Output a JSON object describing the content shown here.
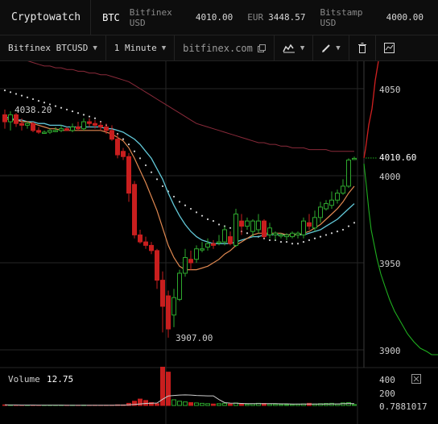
{
  "header": {
    "brand": "Cryptowatch",
    "symbol": "BTC",
    "tickers": [
      {
        "exchange": "Bitfinex USD",
        "value": "4010.00"
      },
      {
        "exchange": "EUR",
        "value": "3448.57"
      },
      {
        "exchange": "Bitstamp USD",
        "value": "4000.00"
      }
    ]
  },
  "toolbar": {
    "market": "Bitfinex BTCUSD",
    "interval": "1 Minute",
    "site": "bitfinex.com"
  },
  "chart_data": {
    "type": "candlestick",
    "price_ticks": [
      "4050",
      "4000",
      "3950",
      "3900"
    ],
    "last_price": "4010.60",
    "high_label": "4038.20",
    "low_label": "3907.00",
    "volume_label": "Volume",
    "volume_value": "12.75",
    "volume_ticks": [
      "400",
      "200",
      "0.7881017"
    ],
    "colors": {
      "up": "#2ea82e",
      "down": "#c81e1e",
      "ma_fast": "#e08850",
      "ma_slow": "#62c8d8",
      "ema": "#8a2a3a"
    },
    "candles": [
      {
        "o": 4035,
        "h": 4038,
        "l": 4027,
        "c": 4031
      },
      {
        "o": 4031,
        "h": 4037,
        "l": 4026,
        "c": 4035
      },
      {
        "o": 4035,
        "h": 4036,
        "l": 4028,
        "c": 4030
      },
      {
        "o": 4030,
        "h": 4033,
        "l": 4026,
        "c": 4029
      },
      {
        "o": 4029,
        "h": 4031,
        "l": 4027,
        "c": 4030
      },
      {
        "o": 4030,
        "h": 4031,
        "l": 4025,
        "c": 4026
      },
      {
        "o": 4026,
        "h": 4028,
        "l": 4024,
        "c": 4025
      },
      {
        "o": 4025,
        "h": 4026,
        "l": 4024,
        "c": 4025
      },
      {
        "o": 4025,
        "h": 4027,
        "l": 4024,
        "c": 4026
      },
      {
        "o": 4026,
        "h": 4028,
        "l": 4025,
        "c": 4026
      },
      {
        "o": 4026,
        "h": 4029,
        "l": 4025,
        "c": 4027
      },
      {
        "o": 4027,
        "h": 4028,
        "l": 4026,
        "c": 4026
      },
      {
        "o": 4026,
        "h": 4030,
        "l": 4025,
        "c": 4028
      },
      {
        "o": 4028,
        "h": 4031,
        "l": 4026,
        "c": 4027
      },
      {
        "o": 4027,
        "h": 4033,
        "l": 4026,
        "c": 4031
      },
      {
        "o": 4031,
        "h": 4033,
        "l": 4028,
        "c": 4030
      },
      {
        "o": 4030,
        "h": 4032,
        "l": 4027,
        "c": 4029
      },
      {
        "o": 4029,
        "h": 4031,
        "l": 4026,
        "c": 4028
      },
      {
        "o": 4028,
        "h": 4030,
        "l": 4024,
        "c": 4026
      },
      {
        "o": 4026,
        "h": 4029,
        "l": 4020,
        "c": 4021
      },
      {
        "o": 4021,
        "h": 4024,
        "l": 4010,
        "c": 4012
      },
      {
        "o": 4014,
        "h": 4016,
        "l": 4009,
        "c": 4011
      },
      {
        "o": 4011,
        "h": 4013,
        "l": 3985,
        "c": 3990
      },
      {
        "o": 3995,
        "h": 3997,
        "l": 3964,
        "c": 3966
      },
      {
        "o": 3966,
        "h": 3969,
        "l": 3961,
        "c": 3962
      },
      {
        "o": 3962,
        "h": 3965,
        "l": 3958,
        "c": 3960
      },
      {
        "o": 3960,
        "h": 3962,
        "l": 3955,
        "c": 3957
      },
      {
        "o": 3957,
        "h": 3958,
        "l": 3935,
        "c": 3940
      },
      {
        "o": 3940,
        "h": 3945,
        "l": 3910,
        "c": 3925
      },
      {
        "o": 3931,
        "h": 3934,
        "l": 3907,
        "c": 3912
      },
      {
        "o": 3920,
        "h": 3935,
        "l": 3913,
        "c": 3930
      },
      {
        "o": 3929,
        "h": 3946,
        "l": 3928,
        "c": 3944
      },
      {
        "o": 3944,
        "h": 3958,
        "l": 3942,
        "c": 3953
      },
      {
        "o": 3952,
        "h": 3957,
        "l": 3946,
        "c": 3950
      },
      {
        "o": 3952,
        "h": 3960,
        "l": 3950,
        "c": 3958
      },
      {
        "o": 3958,
        "h": 3962,
        "l": 3956,
        "c": 3958
      },
      {
        "o": 3959,
        "h": 3964,
        "l": 3957,
        "c": 3961
      },
      {
        "o": 3961,
        "h": 3963,
        "l": 3958,
        "c": 3960
      },
      {
        "o": 3962,
        "h": 3966,
        "l": 3960,
        "c": 3962
      },
      {
        "o": 3962,
        "h": 3971,
        "l": 3960,
        "c": 3969
      },
      {
        "o": 3965,
        "h": 3968,
        "l": 3960,
        "c": 3961
      },
      {
        "o": 3960,
        "h": 3981,
        "l": 3959,
        "c": 3978
      },
      {
        "o": 3974,
        "h": 3978,
        "l": 3966,
        "c": 3971
      },
      {
        "o": 3971,
        "h": 3976,
        "l": 3969,
        "c": 3974
      },
      {
        "o": 3968,
        "h": 3975,
        "l": 3965,
        "c": 3974
      },
      {
        "o": 3969,
        "h": 3978,
        "l": 3967,
        "c": 3974
      },
      {
        "o": 3974,
        "h": 3975,
        "l": 3964,
        "c": 3965
      },
      {
        "o": 3966,
        "h": 3973,
        "l": 3964,
        "c": 3970
      },
      {
        "o": 3966,
        "h": 3968,
        "l": 3963,
        "c": 3967
      },
      {
        "o": 3966,
        "h": 3967,
        "l": 3964,
        "c": 3966
      },
      {
        "o": 3965,
        "h": 3967,
        "l": 3963,
        "c": 3966
      },
      {
        "o": 3965,
        "h": 3968,
        "l": 3964,
        "c": 3967
      },
      {
        "o": 3966,
        "h": 3968,
        "l": 3964,
        "c": 3967
      },
      {
        "o": 3966,
        "h": 3976,
        "l": 3964,
        "c": 3974
      },
      {
        "o": 3973,
        "h": 3978,
        "l": 3969,
        "c": 3971
      },
      {
        "o": 3970,
        "h": 3980,
        "l": 3968,
        "c": 3976
      },
      {
        "o": 3976,
        "h": 3985,
        "l": 3973,
        "c": 3982
      },
      {
        "o": 3981,
        "h": 3986,
        "l": 3980,
        "c": 3984
      },
      {
        "o": 3983,
        "h": 3991,
        "l": 3981,
        "c": 3986
      },
      {
        "o": 3986,
        "h": 3992,
        "l": 3984,
        "c": 3990
      },
      {
        "o": 3990,
        "h": 3998,
        "l": 3989,
        "c": 3994
      },
      {
        "o": 3994,
        "h": 4010,
        "l": 3993,
        "c": 4009
      },
      {
        "o": 4010,
        "h": 4011,
        "l": 4009,
        "c": 4010
      }
    ],
    "volumes": [
      8,
      6,
      5,
      4,
      4,
      5,
      3,
      3,
      4,
      3,
      4,
      3,
      4,
      3,
      5,
      3,
      4,
      3,
      4,
      5,
      9,
      8,
      30,
      60,
      90,
      70,
      40,
      25,
      540,
      470,
      80,
      60,
      50,
      40,
      35,
      30,
      25,
      20,
      25,
      30,
      20,
      35,
      25,
      18,
      22,
      30,
      28,
      20,
      18,
      15,
      12,
      15,
      18,
      22,
      30,
      20,
      25,
      28,
      30,
      20,
      35,
      40,
      13
    ],
    "ma_fast": [
      4033,
      4032,
      4032,
      4031,
      4031,
      4030,
      4029,
      4028,
      4027,
      4027,
      4026,
      4026,
      4026,
      4026,
      4026,
      4026,
      4026,
      4026,
      4025,
      4024,
      4022,
      4020,
      4016,
      4010,
      4003,
      3996,
      3988,
      3980,
      3970,
      3960,
      3953,
      3948,
      3946,
      3946,
      3946,
      3947,
      3948,
      3950,
      3952,
      3955,
      3957,
      3960,
      3962,
      3964,
      3966,
      3967,
      3967,
      3967,
      3967,
      3967,
      3966,
      3966,
      3966,
      3967,
      3968,
      3970,
      3972,
      3975,
      3978,
      3981,
      3985,
      3990,
      3994
    ],
    "ma_slow": [
      4034,
      4033,
      4032,
      4032,
      4031,
      4031,
      4030,
      4030,
      4029,
      4029,
      4029,
      4028,
      4028,
      4028,
      4028,
      4028,
      4028,
      4028,
      4027,
      4027,
      4026,
      4025,
      4023,
      4021,
      4018,
      4014,
      4010,
      4004,
      3998,
      3990,
      3983,
      3977,
      3972,
      3968,
      3965,
      3963,
      3962,
      3961,
      3961,
      3961,
      3961,
      3962,
      3963,
      3964,
      3965,
      3965,
      3966,
      3966,
      3966,
      3966,
      3966,
      3966,
      3966,
      3966,
      3967,
      3968,
      3969,
      3971,
      3973,
      3975,
      3978,
      3981,
      3984
    ],
    "dots": [
      4049,
      4048,
      4047,
      4046,
      4045,
      4044,
      4043,
      4042,
      4041,
      4040,
      4039,
      4038,
      4037,
      4036,
      4035,
      4034,
      4033,
      4031,
      4029,
      4027,
      4024,
      4021,
      4018,
      4014,
      4010,
      4006,
      4002,
      3998,
      3994,
      3991,
      3988,
      3985,
      3983,
      3981,
      3979,
      3977,
      3975,
      3974,
      3972,
      3971,
      3970,
      3969,
      3968,
      3967,
      3966,
      3965,
      3964,
      3963,
      3963,
      3962,
      3962,
      3961,
      3961,
      3962,
      3963,
      3964,
      3965,
      3966,
      3967,
      3968,
      3969,
      3971,
      3973
    ],
    "ema": [
      4068,
      4068,
      4067,
      4066,
      4066,
      4065,
      4064,
      4063,
      4063,
      4062,
      4062,
      4061,
      4061,
      4060,
      4060,
      4059,
      4059,
      4058,
      4058,
      4057,
      4056,
      4055,
      4054,
      4052,
      4050,
      4048,
      4046,
      4044,
      4042,
      4040,
      4038,
      4036,
      4034,
      4032,
      4030,
      4029,
      4028,
      4027,
      4026,
      4025,
      4024,
      4023,
      4022,
      4021,
      4020,
      4019,
      4019,
      4018,
      4018,
      4017,
      4017,
      4016,
      4016,
      4016,
      4015,
      4015,
      4015,
      4015,
      4014,
      4014,
      4014,
      4014,
      4014
    ]
  }
}
